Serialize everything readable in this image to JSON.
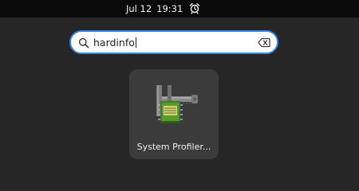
{
  "top_bar": {
    "date": "Jul 12",
    "time": "19:31",
    "alarm_icon": "alarm-clock-icon"
  },
  "search": {
    "value": "hardinfo",
    "search_icon": "search-icon",
    "clear_icon": "clear-text-icon",
    "accent_color": "#3584e4"
  },
  "results": [
    {
      "label": "System Profiler...",
      "icon": "hardinfo-app-icon"
    }
  ]
}
